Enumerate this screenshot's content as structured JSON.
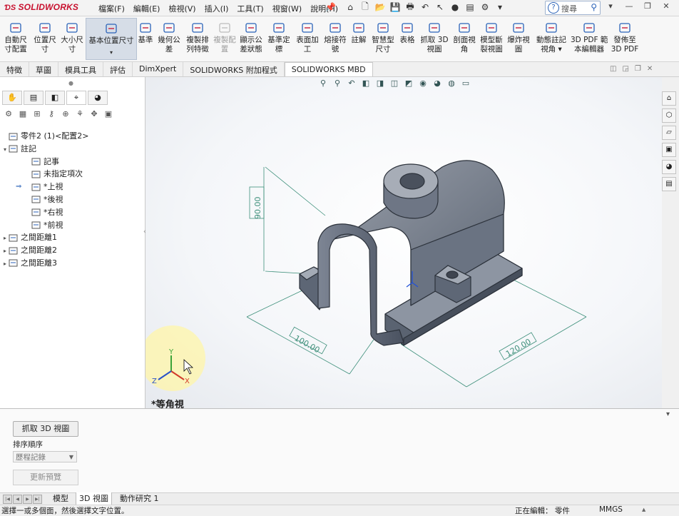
{
  "app": {
    "logo_text": "SOLIDWORKS"
  },
  "menu": [
    "檔案(F)",
    "編輯(E)",
    "檢視(V)",
    "插入(I)",
    "工具(T)",
    "視窗(W)",
    "說明(H)"
  ],
  "search": {
    "label": "搜尋"
  },
  "ribbon": [
    {
      "label": "自動尺\n寸配置",
      "icon": "auto-dimension-icon"
    },
    {
      "label": "位置尺\n寸",
      "icon": "location-dimension-icon"
    },
    {
      "label": "大小尺\n寸",
      "icon": "size-dimension-icon"
    },
    {
      "label": "基本位置尺寸",
      "icon": "basic-location-dimension-icon",
      "active": true
    },
    {
      "label": "基準",
      "icon": "datum-icon"
    },
    {
      "label": "幾何公\n差",
      "icon": "geometric-tolerance-icon"
    },
    {
      "label": "複製排\n列特徵",
      "icon": "copy-pattern-icon"
    },
    {
      "label": "複製配\n置",
      "icon": "copy-scheme-icon",
      "disabled": true
    },
    {
      "label": "顯示公\n差狀態",
      "icon": "tolerance-status-icon"
    },
    {
      "label": "基準定\n標",
      "icon": "datum-target-icon"
    },
    {
      "label": "表面加\n工",
      "icon": "surface-finish-icon"
    },
    {
      "label": "熔接符\n號",
      "icon": "weld-symbol-icon"
    },
    {
      "label": "註解",
      "icon": "note-icon"
    },
    {
      "label": "智慧型\n尺寸",
      "icon": "smart-dimension-icon"
    },
    {
      "label": "表格",
      "icon": "table-icon"
    },
    {
      "label": "抓取 3D\n視圖",
      "icon": "capture-3d-view-icon"
    },
    {
      "label": "剖面視\n角",
      "icon": "section-view-icon"
    },
    {
      "label": "模型斷\n裂視圖",
      "icon": "break-view-icon"
    },
    {
      "label": "爆炸視\n圖",
      "icon": "exploded-view-icon"
    },
    {
      "label": "動態註記\n視角 ▾",
      "icon": "annotation-view-icon"
    },
    {
      "label": "3D PDF 範\n本編輯器",
      "icon": "pdf-template-icon"
    },
    {
      "label": "發佈至\n3D PDF",
      "icon": "publish-pdf-icon"
    }
  ],
  "tabs": [
    "特徵",
    "草圖",
    "模具工具",
    "評估",
    "DimXpert",
    "SOLIDWORKS 附加程式",
    "SOLIDWORKS MBD"
  ],
  "tree": [
    {
      "label": "零件2 (1)<配置2>",
      "level": 0,
      "exp": "",
      "icon": "part-icon"
    },
    {
      "label": "註記",
      "level": 0,
      "exp": "▾",
      "icon": "annotations-icon"
    },
    {
      "label": "記事",
      "level": 1,
      "exp": "",
      "icon": "notes-icon"
    },
    {
      "label": "未指定項次",
      "level": 1,
      "exp": "",
      "icon": "unassigned-items-icon"
    },
    {
      "label": "*上視",
      "level": 1,
      "exp": "",
      "icon": "view-top-icon",
      "arrow": true
    },
    {
      "label": "*後視",
      "level": 1,
      "exp": "",
      "icon": "view-back-icon"
    },
    {
      "label": "*右視",
      "level": 1,
      "exp": "",
      "icon": "view-right-icon"
    },
    {
      "label": "*前視",
      "level": 1,
      "exp": "",
      "icon": "view-front-icon"
    },
    {
      "label": "之間距離1",
      "level": 0,
      "exp": "▸",
      "icon": "distance-icon"
    },
    {
      "label": "之間距離2",
      "level": 0,
      "exp": "▸",
      "icon": "distance-icon"
    },
    {
      "label": "之間距離3",
      "level": 0,
      "exp": "▸",
      "icon": "distance-icon"
    }
  ],
  "viewport": {
    "dim_height": "90.00",
    "dim_width": "100.00",
    "dim_depth": "120.00",
    "view_label": "*等角視",
    "axis_x": "X",
    "axis_y": "Y",
    "axis_z": "Z"
  },
  "bottom_panel": {
    "grab_button": "抓取 3D 視圖",
    "sort_label": "排序順序",
    "sort_value": "歷程記錄",
    "refresh_button": "更新預覽"
  },
  "bottom_tabs": [
    "模型",
    "3D 視圖",
    "動作研究 1"
  ],
  "status": {
    "message": "選擇一或多個面，然後選擇文字位置。",
    "editing": "正在編輯： 零件",
    "units": "MMGS"
  },
  "colors": {
    "brand": "#c8102e",
    "model": "#6c7584",
    "dimension": "#3d8f7a",
    "accent": "#2a62b8"
  }
}
